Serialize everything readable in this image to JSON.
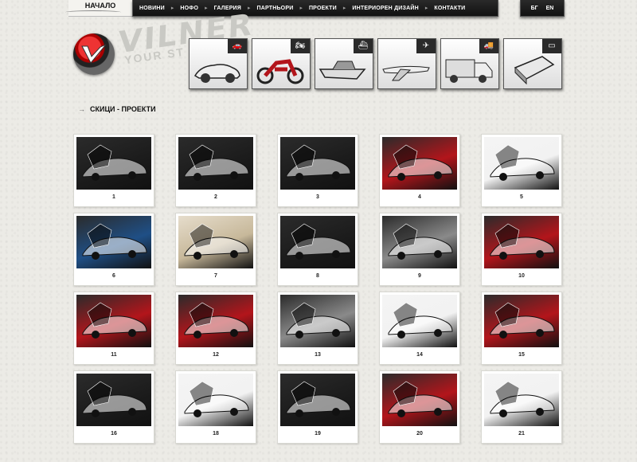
{
  "header": {
    "home_label": "НАЧАЛО",
    "nav": [
      "НОВИНИ",
      "НОФО",
      "ГАЛЕРИЯ",
      "ПАРТНЬОРИ",
      "ПРОЕКТИ",
      "ИНТЕРИОРЕН ДИЗАЙН",
      "КОНТАКТИ"
    ],
    "lang": [
      "БГ",
      "EN"
    ]
  },
  "logo": {
    "word": "VILNER",
    "sub": "YOUR ST"
  },
  "categories": [
    {
      "name": "car",
      "icon": "car-icon"
    },
    {
      "name": "motorcycle",
      "icon": "motorcycle-icon"
    },
    {
      "name": "boat",
      "icon": "boat-icon"
    },
    {
      "name": "plane",
      "icon": "plane-icon"
    },
    {
      "name": "truck",
      "icon": "truck-icon"
    },
    {
      "name": "other",
      "icon": "gadget-icon"
    }
  ],
  "section_title": "СКИЦИ - ПРОЕКТИ",
  "gallery": [
    {
      "num": "1",
      "scheme": "dark"
    },
    {
      "num": "2",
      "scheme": "dark"
    },
    {
      "num": "3",
      "scheme": "dark"
    },
    {
      "num": "4",
      "scheme": "red"
    },
    {
      "num": "5",
      "scheme": "light"
    },
    {
      "num": "6",
      "scheme": "blue"
    },
    {
      "num": "7",
      "scheme": "beige"
    },
    {
      "num": "8",
      "scheme": "dark"
    },
    {
      "num": "9",
      "scheme": "grey"
    },
    {
      "num": "10",
      "scheme": "red"
    },
    {
      "num": "11",
      "scheme": "red"
    },
    {
      "num": "12",
      "scheme": "red"
    },
    {
      "num": "13",
      "scheme": "grey"
    },
    {
      "num": "14",
      "scheme": "light"
    },
    {
      "num": "15",
      "scheme": "red"
    },
    {
      "num": "16",
      "scheme": "dark"
    },
    {
      "num": "18",
      "scheme": "light"
    },
    {
      "num": "19",
      "scheme": "dark"
    },
    {
      "num": "20",
      "scheme": "red"
    },
    {
      "num": "21",
      "scheme": "light"
    }
  ],
  "colors": {
    "red": "#b3151b",
    "dark": "#1c1c1c",
    "grey": "#8a8a8a",
    "light": "#f2f2f2",
    "blue": "#1f4f86",
    "beige": "#c7b89a"
  }
}
